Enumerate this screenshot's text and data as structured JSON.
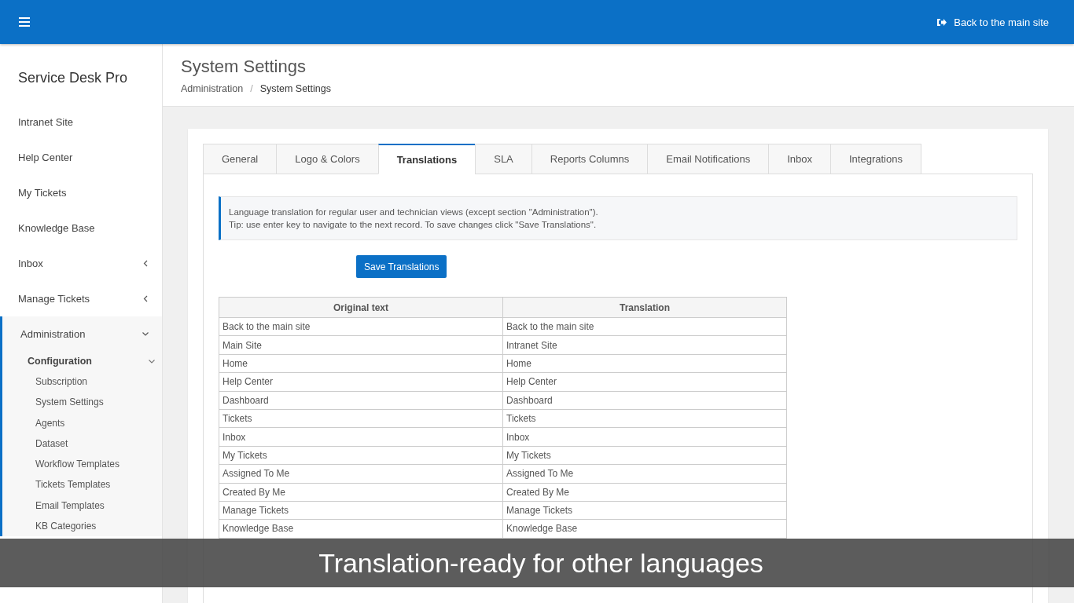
{
  "topbar": {
    "back_link": "Back to the main site"
  },
  "sidebar": {
    "brand": "Service Desk Pro",
    "items": [
      {
        "label": "Intranet Site"
      },
      {
        "label": "Help Center"
      },
      {
        "label": "My Tickets"
      },
      {
        "label": "Knowledge Base"
      },
      {
        "label": "Inbox",
        "expanded": false
      },
      {
        "label": "Manage Tickets",
        "expanded": false
      },
      {
        "label": "Administration",
        "expanded": true,
        "children": [
          {
            "label": "Configuration",
            "expanded": true,
            "children": [
              {
                "label": "Subscription"
              },
              {
                "label": "System Settings"
              },
              {
                "label": "Agents"
              },
              {
                "label": "Dataset"
              },
              {
                "label": "Workflow Templates"
              },
              {
                "label": "Tickets Templates"
              },
              {
                "label": "Email Templates"
              },
              {
                "label": "KB Categories"
              }
            ]
          }
        ]
      }
    ]
  },
  "page": {
    "title": "System Settings",
    "breadcrumb": [
      "Administration",
      "System Settings"
    ],
    "breadcrumb_separator": "/"
  },
  "tabs": [
    {
      "label": "General",
      "selected": false
    },
    {
      "label": "Logo & Colors",
      "selected": false
    },
    {
      "label": "Translations",
      "selected": true
    },
    {
      "label": "SLA",
      "selected": false
    },
    {
      "label": "Reports Columns",
      "selected": false
    },
    {
      "label": "Email Notifications",
      "selected": false
    },
    {
      "label": "Inbox",
      "selected": false
    },
    {
      "label": "Integrations",
      "selected": false
    }
  ],
  "info": [
    "Language translation for regular user and technician views (except section \"Administration\").",
    "Tip: use enter key to navigate to the next record. To save changes click \"Save Translations\"."
  ],
  "save_button": "Save Translations",
  "table": {
    "columns": [
      "Original text",
      "Translation"
    ],
    "rows": [
      [
        "Back to the main site",
        "Back to the main site"
      ],
      [
        "Main Site",
        "Intranet Site"
      ],
      [
        "Home",
        "Home"
      ],
      [
        "Help Center",
        "Help Center"
      ],
      [
        "Dashboard",
        "Dashboard"
      ],
      [
        "Tickets",
        "Tickets"
      ],
      [
        "Inbox",
        "Inbox"
      ],
      [
        "My Tickets",
        "My Tickets"
      ],
      [
        "Assigned To Me",
        "Assigned To Me"
      ],
      [
        "Created By Me",
        "Created By Me"
      ],
      [
        "Manage Tickets",
        "Manage Tickets"
      ],
      [
        "Knowledge Base",
        "Knowledge Base"
      ]
    ]
  },
  "caption": "Translation-ready for other languages"
}
